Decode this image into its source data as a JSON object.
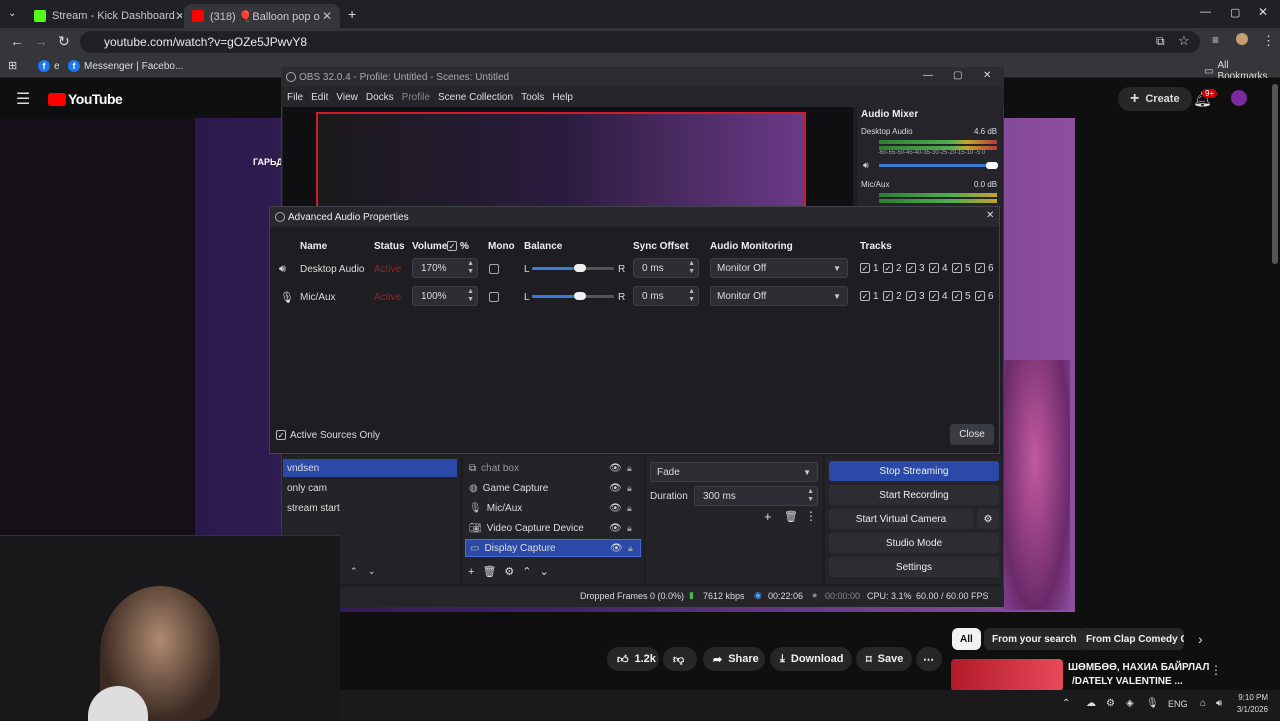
{
  "browser": {
    "tabs": [
      {
        "title": "Stream - Kick Dashboard",
        "favicon_color": "#53fc18"
      },
      {
        "title": "(318) 🎈Balloon pop or find lo",
        "favicon_color": "#ff0000"
      }
    ],
    "new_tab": "+",
    "url": "youtube.com/watch?v=gOZe5JPwvY8",
    "bookmarks": [
      "e",
      "Messenger | Facebo..."
    ],
    "all_bookmarks": "All Bookmarks"
  },
  "youtube": {
    "logo": "YouTube",
    "create": "Create",
    "notif_badge": "9+",
    "side_text": "ГАРЬД",
    "likes": "1.2k",
    "share": "Share",
    "download": "Download",
    "save": "Save",
    "chips": [
      "All",
      "From your search",
      "From Clap Comedy Clu"
    ],
    "rec_title_1": "ШӨМБӨӨ, НАХИА БАЙРЛАЛ",
    "rec_title_2": "/DATELY VALENTINE ..."
  },
  "obs": {
    "title": "OBS 32.0.4 - Profile: Untitled - Scenes: Untitled",
    "menu": [
      "File",
      "Edit",
      "View",
      "Docks",
      "Profile",
      "Scene Collection",
      "Tools",
      "Help"
    ],
    "mixer": {
      "title": "Audio Mixer",
      "channels": [
        {
          "name": "Desktop Audio",
          "db": "4.6 dB"
        },
        {
          "name": "Mic/Aux",
          "db": "0.0 dB"
        }
      ],
      "scale": "-60-55-50-45-40-35-30-25-20-15-10 -5  0"
    },
    "scenes": [
      "vndsen",
      "only cam",
      "stream start"
    ],
    "sources": [
      "chat box",
      "Game Capture",
      "Mic/Aux",
      "Video Capture Device",
      "Display Capture"
    ],
    "transition": {
      "type": "Fade",
      "duration_label": "Duration",
      "duration": "300 ms"
    },
    "controls": [
      "Stop Streaming",
      "Start Recording",
      "Start Virtual Camera",
      "Studio Mode",
      "Settings"
    ],
    "status": {
      "dropped": "Dropped Frames 0 (0.0%)",
      "kbps": "7612 kbps",
      "stream_time": "00:22:06",
      "rec_time": "00:00:00",
      "cpu": "CPU: 3.1%",
      "fps": "60.00 / 60.00 FPS"
    }
  },
  "dialog": {
    "title": "Advanced Audio Properties",
    "headers": {
      "name": "Name",
      "status": "Status",
      "volume": "Volume",
      "pct": "%",
      "mono": "Mono",
      "balance": "Balance",
      "sync": "Sync Offset",
      "monitoring": "Audio Monitoring",
      "tracks": "Tracks"
    },
    "rows": [
      {
        "name": "Desktop Audio",
        "status": "Active",
        "volume": "170%",
        "balance_l": "L",
        "balance_r": "R",
        "sync": "0 ms",
        "monitoring": "Monitor Off",
        "balance_pct": 0.5
      },
      {
        "name": "Mic/Aux",
        "status": "Active",
        "volume": "100%",
        "balance_l": "L",
        "balance_r": "R",
        "sync": "0 ms",
        "monitoring": "Monitor Off",
        "balance_pct": 0.5
      }
    ],
    "tracks": [
      "1",
      "2",
      "3",
      "4",
      "5",
      "6"
    ],
    "active_only": "Active Sources Only",
    "close": "Close"
  },
  "taskbar": {
    "lang": "ENG",
    "time": "9:10 PM",
    "date": "3/1/2026"
  }
}
